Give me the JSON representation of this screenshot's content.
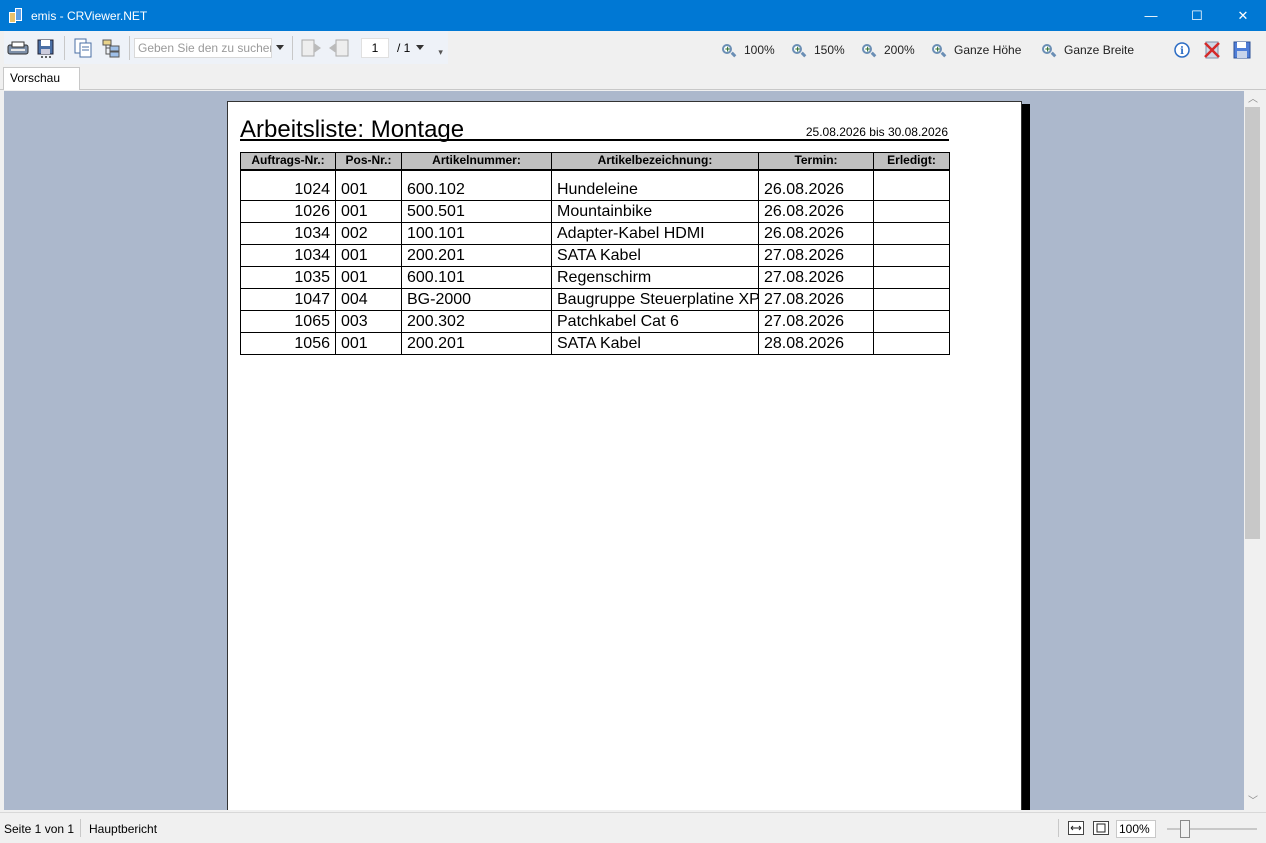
{
  "window": {
    "title": "emis - CRViewer.NET",
    "controls": {
      "minimize": "—",
      "maximize": "☐",
      "close": "✕"
    }
  },
  "toolbar": {
    "search_placeholder": "Geben Sie den zu suchenden Text ein",
    "page_number": "1",
    "page_total": "/ 1",
    "zoom_buttons": [
      "100%",
      "150%",
      "200%",
      "Ganze Höhe",
      "Ganze Breite"
    ],
    "icons": [
      "print-icon",
      "export-icon",
      "copy-icon",
      "group-tree-icon",
      "prev-page-icon",
      "next-page-icon",
      "info-icon",
      "close-report-icon",
      "save-icon"
    ]
  },
  "tabs": [
    "Vorschau"
  ],
  "report": {
    "title": "Arbeitsliste: Montage",
    "date_range": "25.08.2026 bis 30.08.2026",
    "columns": [
      "Auftrags-Nr.:",
      "Pos-Nr.:",
      "Artikelnummer:",
      "Artikelbezeichnung:",
      "Termin:",
      "Erledigt:"
    ],
    "rows": [
      [
        "1024",
        "001",
        "600.102",
        "Hundeleine",
        "26.08.2026",
        ""
      ],
      [
        "1026",
        "001",
        "500.501",
        "Mountainbike",
        "26.08.2026",
        ""
      ],
      [
        "1034",
        "002",
        "100.101",
        "Adapter-Kabel HDMI",
        "26.08.2026",
        ""
      ],
      [
        "1034",
        "001",
        "200.201",
        "SATA Kabel",
        "27.08.2026",
        ""
      ],
      [
        "1035",
        "001",
        "600.101",
        "Regenschirm",
        "27.08.2026",
        ""
      ],
      [
        "1047",
        "004",
        "BG-2000",
        "Baugruppe Steuerplatine XP",
        "27.08.2026",
        ""
      ],
      [
        "1065",
        "003",
        "200.302",
        "Patchkabel Cat 6",
        "27.08.2026",
        ""
      ],
      [
        "1056",
        "001",
        "200.201",
        "SATA Kabel",
        "28.08.2026",
        ""
      ]
    ]
  },
  "statusbar": {
    "page_info": "Seite 1 von 1",
    "report_name": "Hauptbericht",
    "zoom": "100%"
  }
}
